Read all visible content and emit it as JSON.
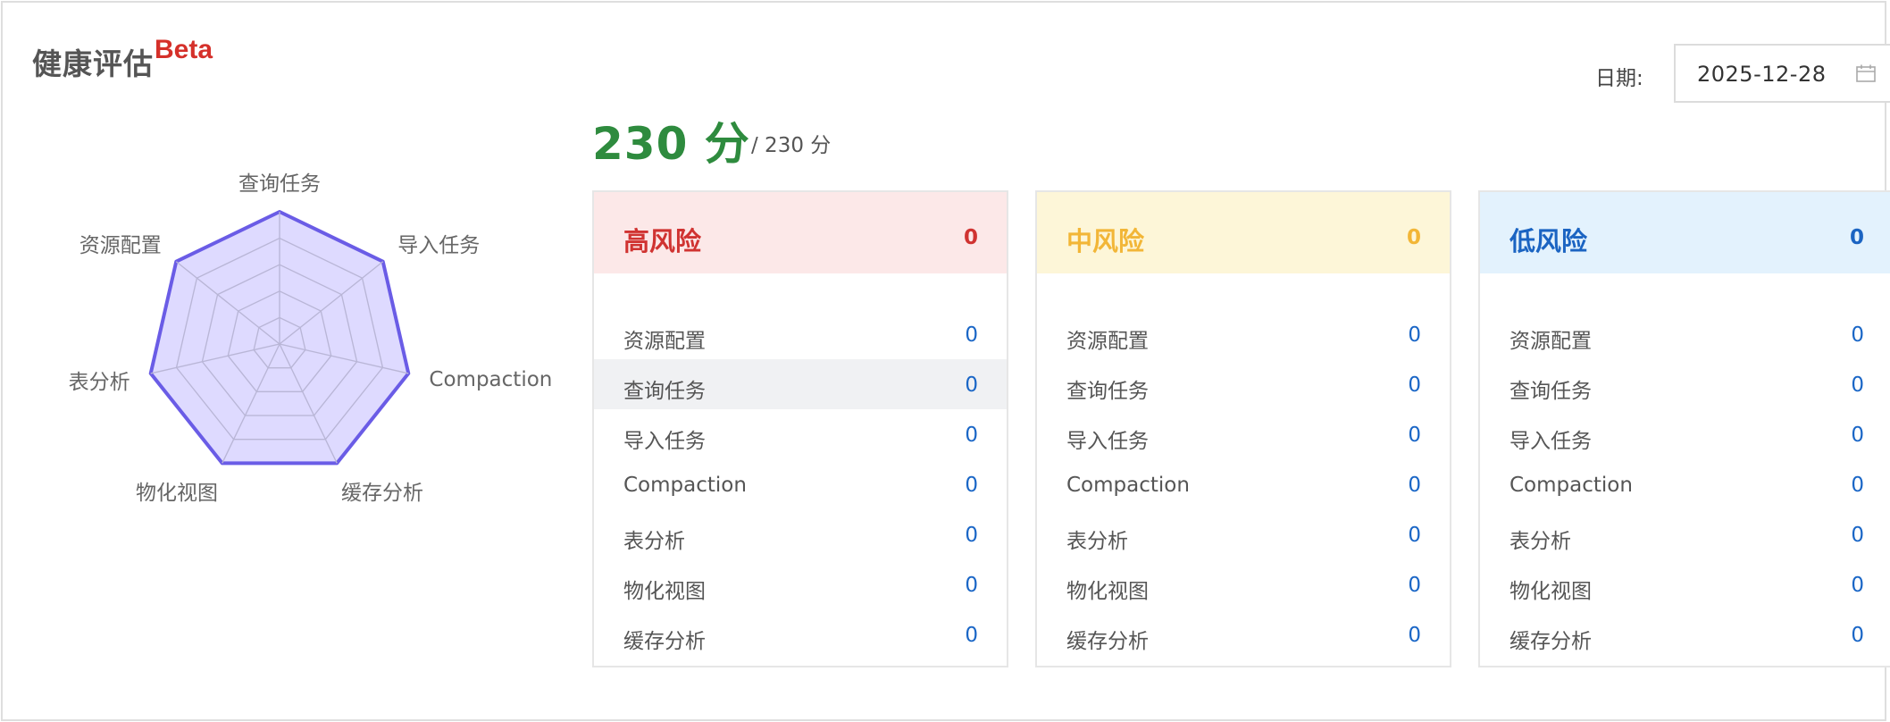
{
  "header": {
    "title": "健康评估",
    "badge": "Beta"
  },
  "date_picker": {
    "label": "日期:",
    "value": "2025-12-28",
    "icon": "calendar-icon"
  },
  "score": {
    "value": "230 分",
    "max": "/  230 分"
  },
  "radar": {
    "axes": [
      "查询任务",
      "导入任务",
      "Compaction",
      "缓存分析",
      "物化视图",
      "表分析",
      "资源配置"
    ],
    "values": [
      1,
      1,
      1,
      1,
      1,
      1,
      1
    ],
    "max": 1,
    "rings": 5,
    "colors": {
      "fill": "#d8d4ff",
      "stroke": "#6a5ce6",
      "grid": "#c9c9d6"
    }
  },
  "cards": [
    {
      "title": "高风险",
      "count": "0",
      "color": "#d03331",
      "rows": [
        {
          "label": "资源配置",
          "value": "0"
        },
        {
          "label": "查询任务",
          "value": "0"
        },
        {
          "label": "导入任务",
          "value": "0"
        },
        {
          "label": "Compaction",
          "value": "0"
        },
        {
          "label": "表分析",
          "value": "0"
        },
        {
          "label": "物化视图",
          "value": "0"
        },
        {
          "label": "缓存分析",
          "value": "0"
        }
      ]
    },
    {
      "title": "中风险",
      "count": "0",
      "color": "#f2b637",
      "rows": [
        {
          "label": "资源配置",
          "value": "0"
        },
        {
          "label": "查询任务",
          "value": "0"
        },
        {
          "label": "导入任务",
          "value": "0"
        },
        {
          "label": "Compaction",
          "value": "0"
        },
        {
          "label": "表分析",
          "value": "0"
        },
        {
          "label": "物化视图",
          "value": "0"
        },
        {
          "label": "缓存分析",
          "value": "0"
        }
      ]
    },
    {
      "title": "低风险",
      "count": "0",
      "color": "#1b64c2",
      "rows": [
        {
          "label": "资源配置",
          "value": "0"
        },
        {
          "label": "查询任务",
          "value": "0"
        },
        {
          "label": "导入任务",
          "value": "0"
        },
        {
          "label": "Compaction",
          "value": "0"
        },
        {
          "label": "表分析",
          "value": "0"
        },
        {
          "label": "物化视图",
          "value": "0"
        },
        {
          "label": "缓存分析",
          "value": "0"
        }
      ]
    }
  ]
}
